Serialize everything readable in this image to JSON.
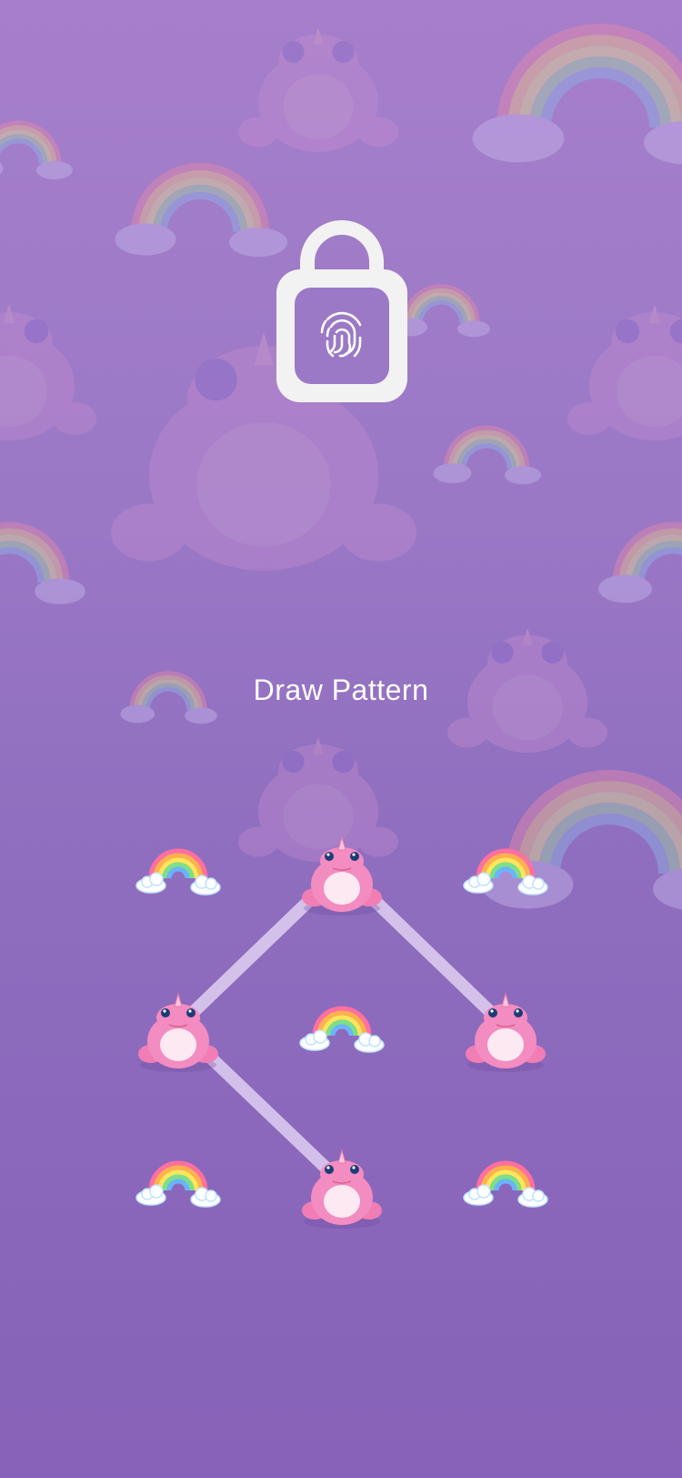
{
  "screen": {
    "title": "Draw Pattern"
  },
  "pattern": {
    "nodes": [
      {
        "row": 1,
        "col": 1,
        "state": "idle",
        "icon": "rainbow-cloud-icon"
      },
      {
        "row": 1,
        "col": 2,
        "state": "selected",
        "icon": "pink-frog-icon"
      },
      {
        "row": 1,
        "col": 3,
        "state": "idle",
        "icon": "rainbow-cloud-icon"
      },
      {
        "row": 2,
        "col": 1,
        "state": "selected",
        "icon": "pink-frog-icon"
      },
      {
        "row": 2,
        "col": 2,
        "state": "idle",
        "icon": "rainbow-cloud-icon"
      },
      {
        "row": 2,
        "col": 3,
        "state": "selected",
        "icon": "pink-frog-icon"
      },
      {
        "row": 3,
        "col": 1,
        "state": "idle",
        "icon": "rainbow-cloud-icon"
      },
      {
        "row": 3,
        "col": 2,
        "state": "selected",
        "icon": "pink-frog-icon"
      },
      {
        "row": 3,
        "col": 3,
        "state": "idle",
        "icon": "rainbow-cloud-icon"
      }
    ],
    "path_order": [
      "r3c2",
      "r2c1",
      "r1c2",
      "r2c3"
    ]
  },
  "colors": {
    "background_top": "#a67fcb",
    "background_bottom": "#8762b8",
    "lock_body": "#f2f2f2",
    "lock_inner": "#9b79c6",
    "connector": "#e0d0f2",
    "text": "#ffffff"
  },
  "icons": {
    "lock": "padlock-open-fingerprint-icon",
    "background": "frog-and-rainbow-wallpaper"
  }
}
